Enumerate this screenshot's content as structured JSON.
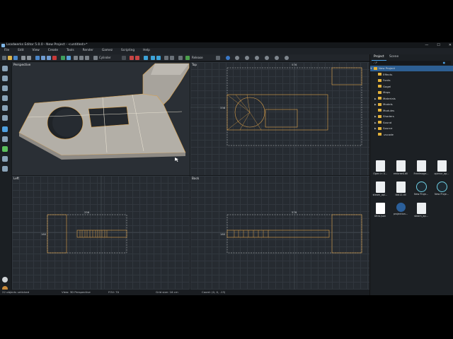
{
  "window": {
    "title": "Leadwerks Editor 5.0.0 - New Project - <untitled>*",
    "minimize": "—",
    "maximize": "☐",
    "close": "✕"
  },
  "menu": [
    "File",
    "Edit",
    "View",
    "Create",
    "Tools",
    "Render",
    "Gamez",
    "Scripting",
    "Help"
  ],
  "toolbar": {
    "cylinder_label": "Cylinder",
    "release_label": "Release"
  },
  "viewports": {
    "perspective": {
      "label": "Perspective"
    },
    "top": {
      "label": "Top",
      "dim_top": "576",
      "dim_left": "338"
    },
    "left": {
      "label": "Left",
      "dim_top": "256",
      "dim_left": "160"
    },
    "back": {
      "label": "Back",
      "dim_top": "576",
      "dim_left": "160"
    }
  },
  "statusbar": {
    "selection": "22 objects unticked",
    "view": "View: 3D Perspective",
    "fov": "FOV: 70",
    "grid": "Grid size: 16 cm",
    "coords": "Coord: (0, 0, -13)"
  },
  "rightpanel": {
    "tabs": [
      "Project",
      "Scene"
    ],
    "search_placeholder": "..\\P",
    "tree": [
      {
        "label": "New Project",
        "arrow": "▼",
        "selected": true
      },
      {
        "label": "Effects",
        "arrow": ""
      },
      {
        "label": "Fonts",
        "arrow": ""
      },
      {
        "label": "Gogel",
        "arrow": ""
      },
      {
        "label": "Maps",
        "arrow": ""
      },
      {
        "label": "Materials",
        "arrow": "▶"
      },
      {
        "label": "Models",
        "arrow": "▶"
      },
      {
        "label": "Modules",
        "arrow": ""
      },
      {
        "label": "Shaders",
        "arrow": "▶"
      },
      {
        "label": "Sound",
        "arrow": "▶"
      },
      {
        "label": "Source",
        "arrow": "▶"
      },
      {
        "label": ".vscode",
        "arrow": ""
      }
    ],
    "files": [
      {
        "name": "Open in V...",
        "kind": "doc"
      },
      {
        "name": "embree4.dll",
        "kind": "doc"
      },
      {
        "name": "FreeImage...",
        "kind": "doc"
      },
      {
        "name": "openxr_ap...",
        "kind": "doc"
      },
      {
        "name": "steam_api...",
        "kind": "doc"
      },
      {
        "name": "tbb12.dll",
        "kind": "doc"
      },
      {
        "name": "New Proje...",
        "kind": "dark"
      },
      {
        "name": "New Proje...",
        "kind": "dark"
      },
      {
        "name": "Ultra.json",
        "kind": "json"
      },
      {
        "name": "projection...",
        "kind": "blue"
      },
      {
        "name": "steam_ap...",
        "kind": "doc"
      }
    ]
  },
  "colors": {
    "accent": "#4aa0e6",
    "folder": "#e4b23a",
    "selection_outline": "#e0a34a"
  }
}
